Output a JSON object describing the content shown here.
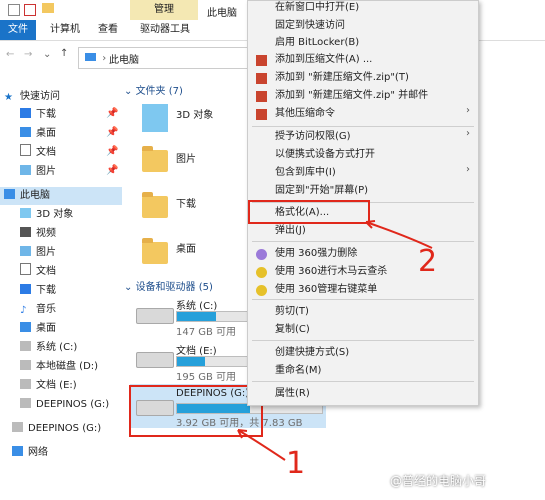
{
  "ribbon": {
    "manage": "管理",
    "this_pc": "此电脑",
    "tabs": [
      "文件",
      "计算机",
      "查看",
      "驱动器工具"
    ]
  },
  "address": {
    "path": "此电脑"
  },
  "nav": {
    "quick_access": "快速访问",
    "quick_items": [
      "下载",
      "桌面",
      "文档",
      "图片"
    ],
    "this_pc": "此电脑",
    "pc_items": [
      "3D 对象",
      "视频",
      "图片",
      "文档",
      "下载",
      "音乐",
      "桌面",
      "系统 (C:)",
      "本地磁盘 (D:)",
      "文档 (E:)",
      "DEEPINOS (G:)"
    ],
    "deepinos": "DEEPINOS (G:)",
    "network": "网络"
  },
  "content": {
    "folders_header": "文件夹 (7)",
    "folders": [
      "3D 对象",
      "图片",
      "下载",
      "桌面"
    ],
    "drives_header": "设备和驱动器 (5)",
    "drives": [
      {
        "name": "系统 (C:)",
        "info": "147 GB 可用",
        "used": 0.55
      },
      {
        "name": "文档 (E:)",
        "info": "195 GB 可用",
        "used": 0.4
      },
      {
        "name": "DEEPINOS (G:)",
        "info": "3.92 GB 可用，共 7.83 GB",
        "used": 0.5
      }
    ]
  },
  "menu": {
    "items": [
      "在新窗口中打开(E)",
      "固定到快速访问",
      "启用 BitLocker(B)",
      "添加到压缩文件(A) ...",
      "添加到 \"新建压缩文件.zip\"(T)",
      "添加到 \"新建压缩文件.zip\" 并邮件",
      "其他压缩命令",
      "授予访问权限(G)",
      "以便携式设备方式打开",
      "包含到库中(I)",
      "固定到\"开始\"屏幕(P)",
      "格式化(A)...",
      "弹出(J)",
      "使用 360强力删除",
      "使用 360进行木马云查杀",
      "使用 360管理右键菜单",
      "剪切(T)",
      "复制(C)",
      "创建快捷方式(S)",
      "重命名(M)",
      "属性(R)"
    ]
  },
  "annotations": {
    "one": "1",
    "two": "2"
  },
  "watermark": "@普经的电脑小哥"
}
